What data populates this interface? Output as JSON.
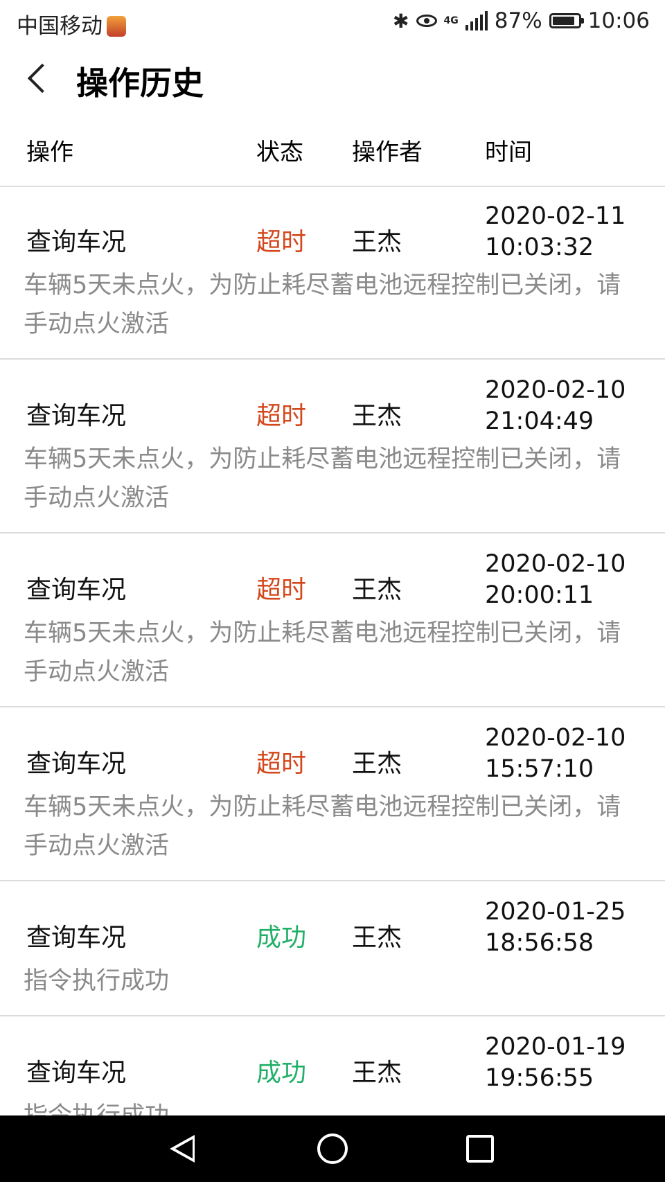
{
  "status_bar": {
    "carrier": "中国移动",
    "network": "4G",
    "battery_percent": "87%",
    "time": "10:06"
  },
  "header": {
    "title": "操作历史"
  },
  "columns": {
    "operation": "操作",
    "status": "状态",
    "operator": "操作者",
    "time": "时间"
  },
  "records": [
    {
      "operation": "查询车况",
      "status": "超时",
      "operator": "王杰",
      "date": "2020-02-11",
      "clock": "10:03:32",
      "detail": "车辆5天未点火，为防止耗尽蓄电池远程控制已关闭，请手动点火激活"
    },
    {
      "operation": "查询车况",
      "status": "超时",
      "operator": "王杰",
      "date": "2020-02-10",
      "clock": "21:04:49",
      "detail": "车辆5天未点火，为防止耗尽蓄电池远程控制已关闭，请手动点火激活"
    },
    {
      "operation": "查询车况",
      "status": "超时",
      "operator": "王杰",
      "date": "2020-02-10",
      "clock": "20:00:11",
      "detail": "车辆5天未点火，为防止耗尽蓄电池远程控制已关闭，请手动点火激活"
    },
    {
      "operation": "查询车况",
      "status": "超时",
      "operator": "王杰",
      "date": "2020-02-10",
      "clock": "15:57:10",
      "detail": "车辆5天未点火，为防止耗尽蓄电池远程控制已关闭，请手动点火激活"
    },
    {
      "operation": "查询车况",
      "status": "成功",
      "operator": "王杰",
      "date": "2020-01-25",
      "clock": "18:56:58",
      "detail": "指令执行成功"
    },
    {
      "operation": "查询车况",
      "status": "成功",
      "operator": "王杰",
      "date": "2020-01-19",
      "clock": "19:56:55",
      "detail": "指令执行成功"
    }
  ],
  "colors": {
    "timeout": "#d3481c",
    "success": "#22b068",
    "detail_text": "#8a8a8a",
    "divider": "#dcdcdc"
  }
}
